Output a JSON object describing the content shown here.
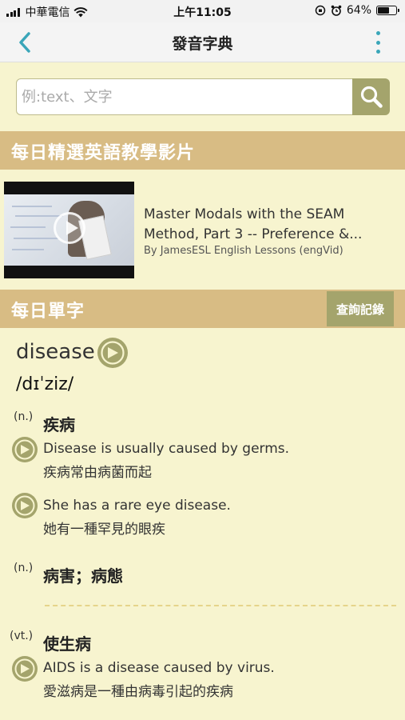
{
  "status": {
    "carrier": "中華電信",
    "time": "上午11:05",
    "battery_text": "64%",
    "battery_level": 0.64
  },
  "nav": {
    "title": "發音字典"
  },
  "search": {
    "placeholder": "例:text、文字"
  },
  "video_section": {
    "header": "每日精選英語教學影片",
    "video": {
      "title_line1": "Master Modals with the SEAM",
      "title_line2": "Method, Part 3 -- Preference &...",
      "channel": "By JamesESL English Lessons (engVid)"
    }
  },
  "word_section": {
    "header": "每日單字",
    "history_button": "查詢記錄",
    "word": "disease",
    "phonetic": "/dɪˈziz/",
    "senses": [
      {
        "pos": "(n.)",
        "definition": "疾病",
        "examples": [
          {
            "en": "Disease is usually caused by germs.",
            "zh": "疾病常由病菌而起"
          },
          {
            "en": "She has a rare eye disease.",
            "zh": "她有一種罕見的眼疾"
          }
        ]
      },
      {
        "pos": "(n.)",
        "definition": "病害；病態",
        "examples": []
      },
      {
        "pos": "(vt.)",
        "definition": "使生病",
        "examples": [
          {
            "en": "AIDS is a disease caused by virus.",
            "zh": "愛滋病是一種由病毒引起的疾病"
          }
        ]
      }
    ]
  },
  "colors": {
    "background": "#f7f4cf",
    "section_header": "#d8bc84",
    "button": "#a4a46c",
    "accent": "#3aa6b9"
  }
}
